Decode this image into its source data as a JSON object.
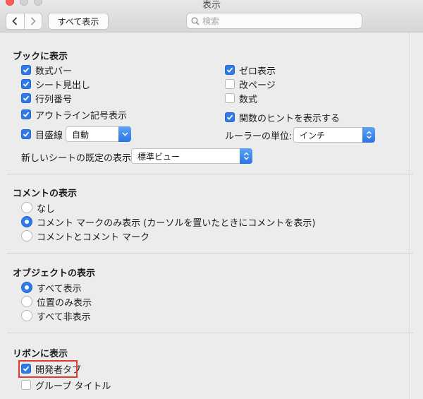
{
  "window": {
    "title": "表示"
  },
  "toolbar": {
    "show_all_label": "すべて表示"
  },
  "search": {
    "placeholder": "検索"
  },
  "book": {
    "title": "ブックに表示",
    "formula_bar": "数式バー",
    "sheet_headers": "シート見出し",
    "row_col_headers": "行列番号",
    "outline_symbols": "アウトライン記号表示",
    "gridlines": "目盛線",
    "gridlines_color": "自動",
    "zero_values": "ゼロ表示",
    "page_breaks": "改ページ",
    "formulas": "数式",
    "function_hints": "関数のヒントを表示する",
    "ruler_units_label": "ルーラーの単位:",
    "ruler_units_value": "インチ",
    "default_view_label": "新しいシートの既定の表示:",
    "default_view_value": "標準ビュー"
  },
  "comments": {
    "title": "コメントの表示",
    "none": "なし",
    "indicators_only": "コメント マークのみ表示 (カーソルを置いたときにコメントを表示)",
    "comments_and_indicators": "コメントとコメント マーク"
  },
  "objects": {
    "title": "オブジェクトの表示",
    "show_all": "すべて表示",
    "placeholders": "位置のみ表示",
    "hide_all": "すべて非表示"
  },
  "ribbon": {
    "title": "リボンに表示",
    "developer_tab": "開発者タブ",
    "group_titles": "グループ タイトル"
  },
  "colors": {
    "accent": "#2f7ae5",
    "highlight": "#e23a2e"
  }
}
